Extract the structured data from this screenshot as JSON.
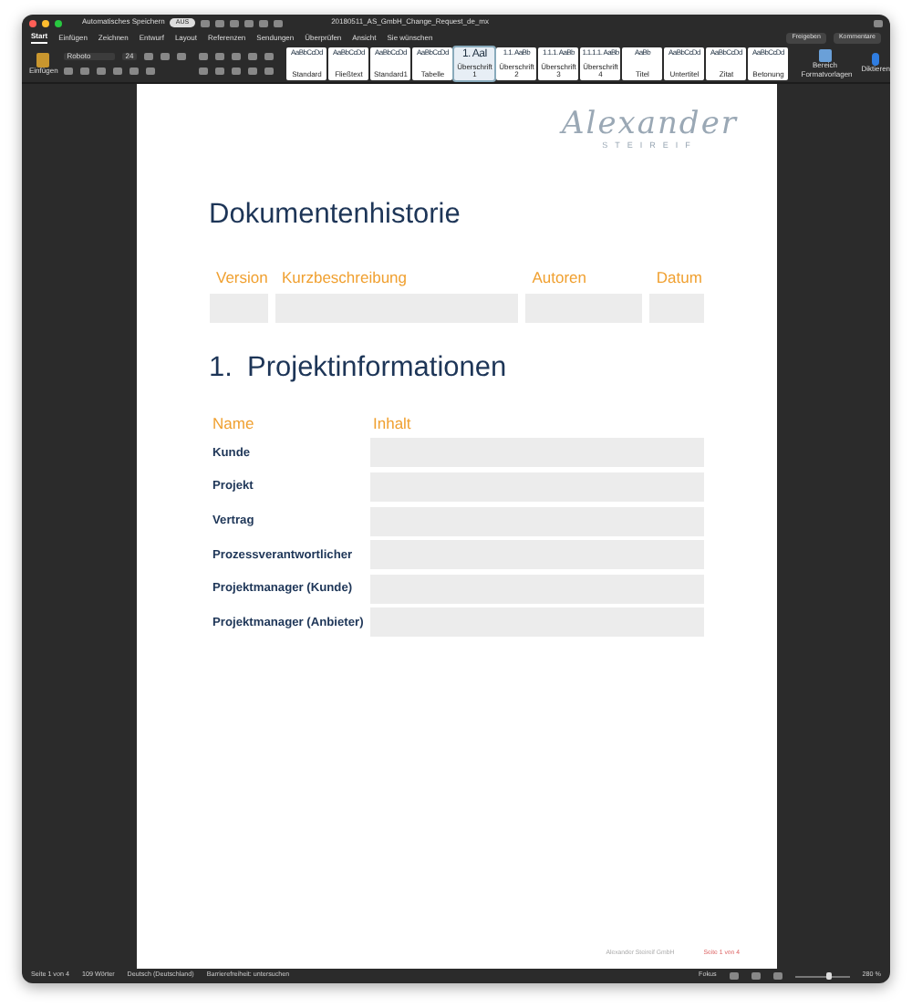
{
  "title_bar": {
    "autosave_label": "Automatisches Speichern",
    "autosave_toggle": {
      "label": "AUS",
      "on": false
    },
    "document_title": "20180511_AS_GmbH_Change_Request_de_mx"
  },
  "menu_tabs": [
    {
      "label": "Start",
      "selected": true
    },
    {
      "label": "Einfügen",
      "selected": false
    },
    {
      "label": "Zeichnen",
      "selected": false
    },
    {
      "label": "Entwurf",
      "selected": false
    },
    {
      "label": "Layout",
      "selected": false
    },
    {
      "label": "Referenzen",
      "selected": false
    },
    {
      "label": "Sendungen",
      "selected": false
    },
    {
      "label": "Überprüfen",
      "selected": false
    },
    {
      "label": "Ansicht",
      "selected": false
    }
  ],
  "tell_me": "Sie wünschen",
  "header_buttons": [
    "Freigeben",
    "Kommentare"
  ],
  "ribbon": {
    "paste_label": "Einfügen",
    "font": "Roboto",
    "font_size": "24",
    "styles": [
      {
        "preview": "AaBbCcDd",
        "name": "Standard",
        "selected": false
      },
      {
        "preview": "AaBbCcDd",
        "name": "Fließtext",
        "selected": false
      },
      {
        "preview": "AaBbCcDd",
        "name": "Standard1",
        "selected": false
      },
      {
        "preview": "AaBbCcDd",
        "name": "Tabelle",
        "selected": false
      },
      {
        "preview": "1. AaI",
        "name": "Überschrift 1",
        "selected": true
      },
      {
        "preview": "1.1. AaBb",
        "name": "Überschrift 2",
        "selected": false
      },
      {
        "preview": "1.1.1. AaBb",
        "name": "Überschrift 3",
        "selected": false
      },
      {
        "preview": "1.1.1.1. AaBb",
        "name": "Überschrift 4",
        "selected": false
      },
      {
        "preview": "AaBb",
        "name": "Titel",
        "selected": false
      },
      {
        "preview": "AaBbCcDd",
        "name": "Untertitel",
        "selected": false
      },
      {
        "preview": "AaBbCcDd",
        "name": "Zitat",
        "selected": false
      },
      {
        "preview": "AaBbCcDd",
        "name": "Betonung",
        "selected": false
      }
    ],
    "styles_pane": "Bereich Formatvorlagen",
    "dictate": "Diktieren"
  },
  "document": {
    "logo": {
      "script": "Alexander",
      "subtitle": "STEIREIF"
    },
    "history_heading": "Dokumentenhistorie",
    "history_table": {
      "columns": [
        "Version",
        "Kurzbeschreibung",
        "Autoren",
        "Datum"
      ]
    },
    "section_number": "1.",
    "section_heading": "Projektinformationen",
    "info_table": {
      "columns": [
        "Name",
        "Inhalt"
      ],
      "rows": [
        "Kunde",
        "Projekt",
        "Vertrag",
        "Prozessverantwortlicher",
        "Projektmanager (Kunde)",
        "Projektmanager (Anbieter)"
      ]
    },
    "footer": {
      "company": "Alexander Steireif GmbH",
      "page": "Seite 1 von 4"
    }
  },
  "status_bar": {
    "page": "Seite 1 von 4",
    "words": "109 Wörter",
    "language": "Deutsch (Deutschland)",
    "accessibility": "Barrierefreiheit: untersuchen",
    "focus": "Fokus",
    "zoom": "280 %",
    "zoom_slider": {
      "level": 0.62
    }
  }
}
